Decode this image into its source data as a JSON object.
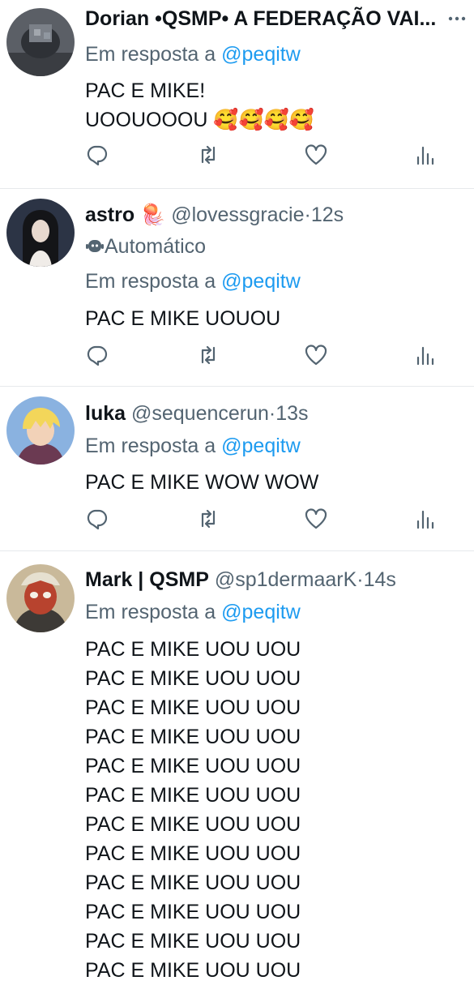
{
  "tweets": [
    {
      "name": "Dorian •QSMP• A FEDERAÇÃO VAI...",
      "reply_prefix": "Em resposta a",
      "reply_to": "@peqitw",
      "lines": [
        "PAC E MIKE!",
        "UOOUOOOU 🥰🥰🥰🥰"
      ]
    },
    {
      "name": "astro",
      "emoji": "🪼",
      "handle": "@lovessgracie",
      "time": "12s",
      "automated_label": "Automático",
      "reply_prefix": "Em resposta a",
      "reply_to": "@peqitw",
      "lines": [
        "PAC E MIKE UOUOU"
      ]
    },
    {
      "name": "luka",
      "handle": "@sequencerun",
      "time": "13s",
      "reply_prefix": "Em resposta a",
      "reply_to": "@peqitw",
      "lines": [
        "PAC E MIKE WOW WOW"
      ]
    },
    {
      "name": "Mark | QSMP",
      "handle": "@sp1dermaarK",
      "time": "14s",
      "reply_prefix": "Em resposta a",
      "reply_to": "@peqitw",
      "lines": [
        "PAC E MIKE UOU UOU",
        "PAC E MIKE UOU UOU",
        "PAC E MIKE UOU UOU",
        "PAC E MIKE UOU UOU",
        "PAC E MIKE UOU UOU",
        "PAC E MIKE UOU UOU",
        "PAC E MIKE UOU UOU",
        "PAC E MIKE UOU UOU",
        "PAC E MIKE UOU UOU",
        "PAC E MIKE UOU UOU",
        "PAC E MIKE UOU UOU",
        "PAC E MIKE UOU UOU"
      ]
    }
  ],
  "separator": "·",
  "icons": {
    "reply": "reply-icon",
    "retweet": "retweet-icon",
    "like": "heart-icon",
    "views": "views-icon",
    "more": "more-icon",
    "bot": "bot-icon"
  },
  "colors": {
    "text": "#0f1419",
    "secondary": "#536471",
    "mention": "#1d9bf0",
    "divider": "#e6e9ec"
  }
}
